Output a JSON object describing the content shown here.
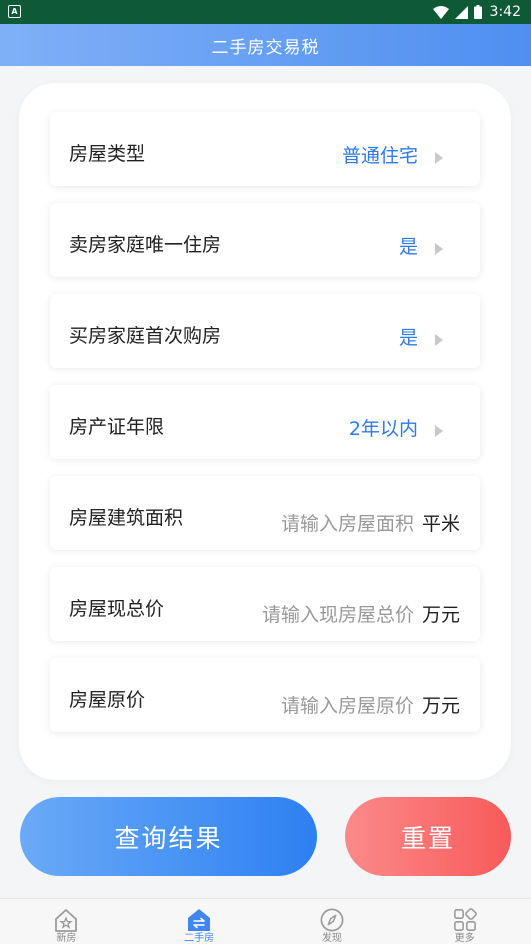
{
  "status_bar": {
    "time": "3:42"
  },
  "header": {
    "title": "二手房交易税"
  },
  "form": {
    "rows": [
      {
        "label": "房屋类型",
        "value": "普通住宅"
      },
      {
        "label": "卖房家庭唯一住房",
        "value": "是"
      },
      {
        "label": "买房家庭首次购房",
        "value": "是"
      },
      {
        "label": "房产证年限",
        "value": "2年以内"
      },
      {
        "label": "房屋建筑面积",
        "placeholder": "请输入房屋面积",
        "unit": "平米"
      },
      {
        "label": "房屋现总价",
        "placeholder": "请输入现房屋总价",
        "unit": "万元"
      },
      {
        "label": "房屋原价",
        "placeholder": "请输入房屋原价",
        "unit": "万元"
      }
    ]
  },
  "actions": {
    "query_label": "查询结果",
    "reset_label": "重置"
  },
  "bottom_nav": {
    "items": [
      {
        "label": "新房",
        "icon": "house-star-icon",
        "active": false
      },
      {
        "label": "二手房",
        "icon": "house-swap-icon",
        "active": true
      },
      {
        "label": "发现",
        "icon": "compass-icon",
        "active": false
      },
      {
        "label": "更多",
        "icon": "grid-more-icon",
        "active": false
      }
    ]
  },
  "colors": {
    "accent": "#2f7ae5",
    "reset": "#f85a5a",
    "status_bar": "#0f5a36"
  }
}
